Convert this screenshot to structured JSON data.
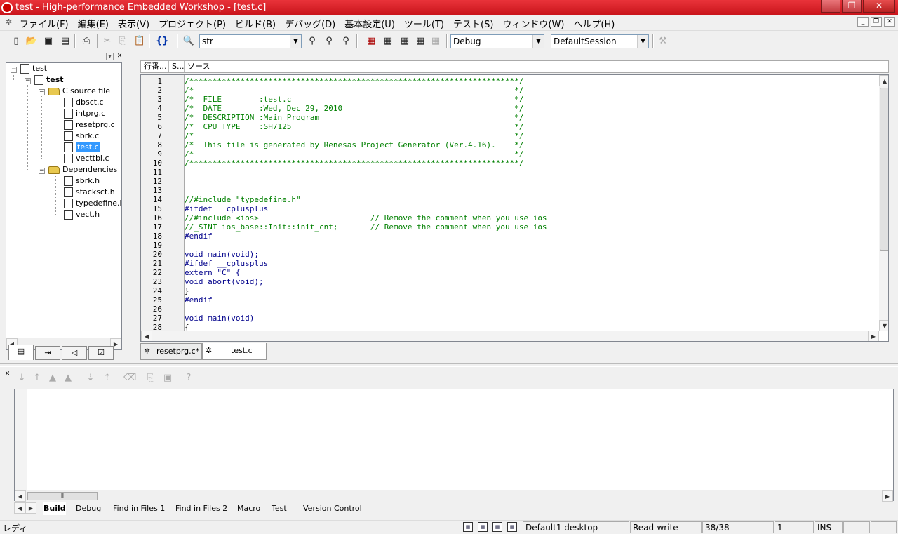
{
  "window": {
    "title": "test - High-performance Embedded Workshop - [test.c]",
    "controls": [
      "—",
      "❐",
      "✕"
    ]
  },
  "menubar": {
    "items": [
      "ファイル(F)",
      "編集(E)",
      "表示(V)",
      "プロジェクト(P)",
      "ビルド(B)",
      "デバッグ(D)",
      "基本設定(U)",
      "ツール(T)",
      "テスト(S)",
      "ウィンドウ(W)",
      "ヘルプ(H)"
    ],
    "mdi_controls": [
      "_",
      "❐",
      "✕"
    ]
  },
  "toolbar": {
    "find_value": "str",
    "config_value": "Debug",
    "session_value": "DefaultSession"
  },
  "workspace": {
    "tree": {
      "root": "test",
      "project": "test",
      "folder1": "C source file",
      "files": [
        "dbsct.c",
        "intprg.c",
        "resetprg.c",
        "sbrk.c",
        "test.c",
        "vecttbl.c"
      ],
      "folder2": "Dependencies",
      "deps": [
        "sbrk.h",
        "stacksct.h",
        "typedefine.h",
        "vect.h"
      ]
    }
  },
  "editor": {
    "columns": [
      "行番...",
      "S...",
      "ソース"
    ],
    "lines": [
      {
        "n": "1",
        "t": "/***********************************************************************/",
        "c": "cm"
      },
      {
        "n": "2",
        "t": "/*                                                                     */",
        "c": "cm"
      },
      {
        "n": "3",
        "t": "/*  FILE        :test.c                                                */",
        "c": "cm"
      },
      {
        "n": "4",
        "t": "/*  DATE        :Wed, Dec 29, 2010                                     */",
        "c": "cm"
      },
      {
        "n": "5",
        "t": "/*  DESCRIPTION :Main Program                                          */",
        "c": "cm"
      },
      {
        "n": "6",
        "t": "/*  CPU TYPE    :SH7125                                                */",
        "c": "cm"
      },
      {
        "n": "7",
        "t": "/*                                                                     */",
        "c": "cm"
      },
      {
        "n": "8",
        "t": "/*  This file is generated by Renesas Project Generator (Ver.4.16).    */",
        "c": "cm"
      },
      {
        "n": "9",
        "t": "/*                                                                     */",
        "c": "cm"
      },
      {
        "n": "10",
        "t": "/***********************************************************************/",
        "c": "cm"
      },
      {
        "n": "11",
        "t": "",
        "c": "tx"
      },
      {
        "n": "12",
        "t": "",
        "c": "tx"
      },
      {
        "n": "13",
        "t": "",
        "c": "tx"
      },
      {
        "n": "14",
        "t": "//#include \"typedefine.h\"",
        "c": "cm"
      },
      {
        "n": "15",
        "t": "#ifdef __cplusplus",
        "c": "kw"
      },
      {
        "n": "16",
        "t": "//#include <ios>                        // Remove the comment when you use ios",
        "c": "cm"
      },
      {
        "n": "17",
        "t": "//_SINT ios_base::Init::init_cnt;       // Remove the comment when you use ios",
        "c": "cm"
      },
      {
        "n": "18",
        "t": "#endif",
        "c": "kw"
      },
      {
        "n": "19",
        "t": "",
        "c": "tx"
      },
      {
        "n": "20",
        "t": "void main(void);",
        "c": "kw"
      },
      {
        "n": "21",
        "t": "#ifdef __cplusplus",
        "c": "kw"
      },
      {
        "n": "22",
        "t": "extern \"C\" {",
        "c": "kw"
      },
      {
        "n": "23",
        "t": "void abort(void);",
        "c": "kw"
      },
      {
        "n": "24",
        "t": "}",
        "c": "tx"
      },
      {
        "n": "25",
        "t": "#endif",
        "c": "kw"
      },
      {
        "n": "26",
        "t": "",
        "c": "tx"
      },
      {
        "n": "27",
        "t": "void main(void)",
        "c": "kw"
      },
      {
        "n": "28",
        "t": "{",
        "c": "tx"
      }
    ],
    "tabs": [
      "resetprg.c*",
      "test.c"
    ],
    "active_tab": "test.c"
  },
  "output": {
    "tabs": [
      "Build",
      "Debug",
      "Find in Files 1",
      "Find in Files 2",
      "Macro",
      "Test",
      "Version Control"
    ],
    "active_tab": "Build"
  },
  "statusbar": {
    "message": "レディ",
    "desktop": "Default1 desktop",
    "mode": "Read-write",
    "lines": "38/38",
    "column": "1",
    "insert": "INS"
  }
}
